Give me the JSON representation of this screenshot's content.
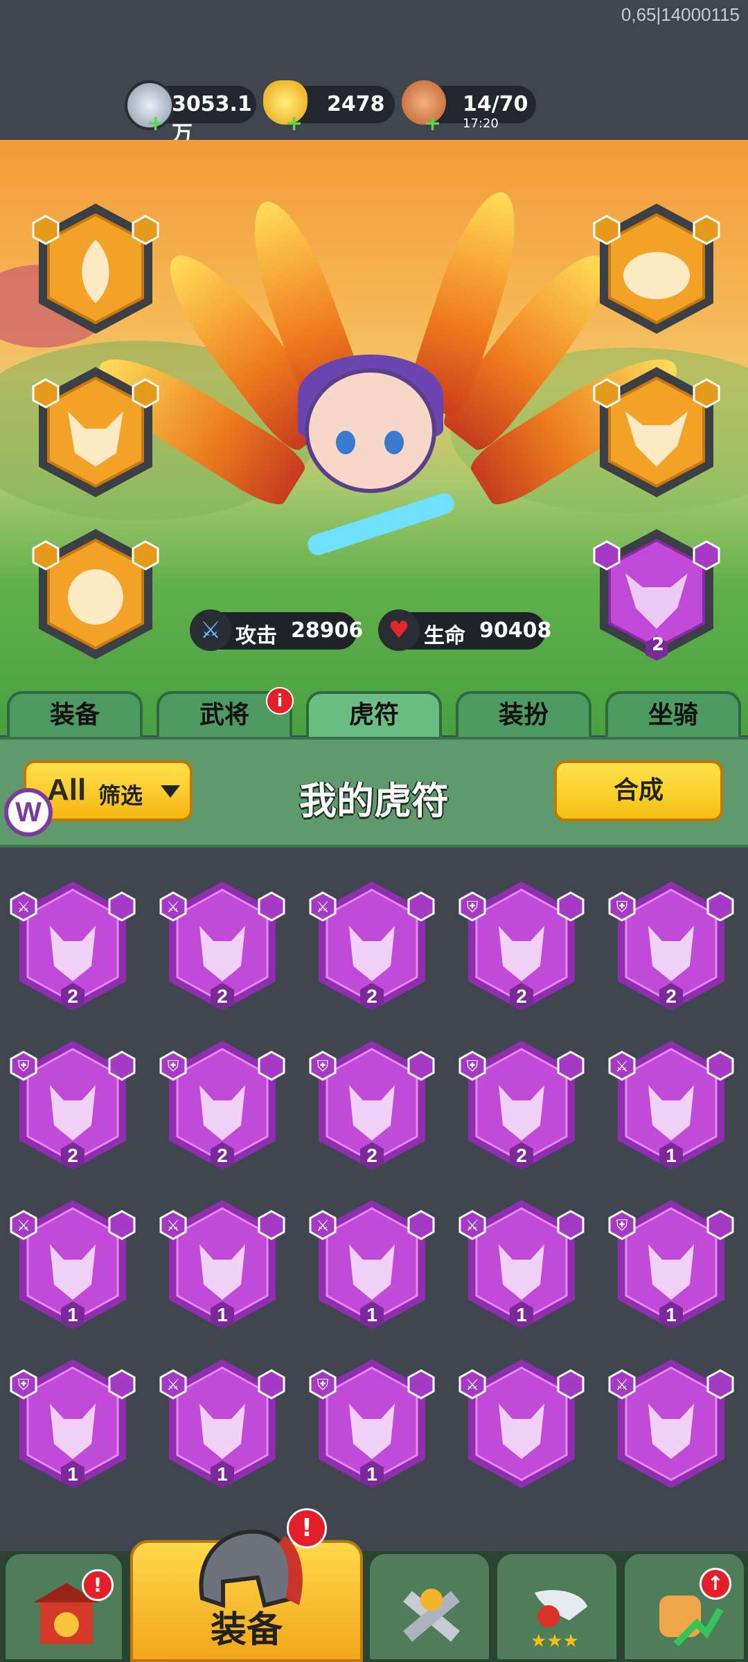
{
  "debug_text": "0,65|14000115",
  "resources": [
    {
      "name": "silver",
      "value": "3053.1万",
      "icon": "silver-coin-icon"
    },
    {
      "name": "gold",
      "value": "2478",
      "icon": "gold-ingot-icon"
    },
    {
      "name": "stamina",
      "value": "14/70",
      "timer": "17:20",
      "icon": "meat-icon"
    }
  ],
  "stats": {
    "attack_label": "攻击",
    "attack_value": "28906",
    "hp_label": "生命",
    "hp_value": "90408"
  },
  "equipped_slots": [
    {
      "side": "left",
      "beast": "phoenix",
      "rarity": "orange",
      "level": ""
    },
    {
      "side": "left",
      "beast": "fox",
      "rarity": "orange",
      "level": ""
    },
    {
      "side": "left",
      "beast": "lion",
      "rarity": "orange",
      "level": ""
    },
    {
      "side": "right",
      "beast": "turtle",
      "rarity": "orange",
      "level": ""
    },
    {
      "side": "right",
      "beast": "ox-skull",
      "rarity": "orange",
      "level": ""
    },
    {
      "side": "right",
      "beast": "ox-skull",
      "rarity": "purple",
      "level": "2"
    }
  ],
  "tabs": [
    {
      "label": "装备",
      "active": false,
      "badge": ""
    },
    {
      "label": "武将",
      "active": false,
      "badge": "i"
    },
    {
      "label": "虎符",
      "active": true,
      "badge": ""
    },
    {
      "label": "装扮",
      "active": false,
      "badge": ""
    },
    {
      "label": "坐骑",
      "active": false,
      "badge": ""
    }
  ],
  "filter": {
    "all_label": "All",
    "label": "筛选"
  },
  "title": "我的虎符",
  "compose_label": "合成",
  "logo_letter": "W",
  "items": [
    {
      "beast": "deer",
      "type": "sword",
      "level": "2"
    },
    {
      "beast": "tiger",
      "type": "sword",
      "level": "2"
    },
    {
      "beast": "dragon",
      "type": "sword",
      "level": "2"
    },
    {
      "beast": "dragon",
      "type": "shield",
      "level": "2"
    },
    {
      "beast": "wolf",
      "type": "shield",
      "level": "2"
    },
    {
      "beast": "turtle",
      "type": "shield",
      "level": "2"
    },
    {
      "beast": "phoenix",
      "type": "shield",
      "level": "2"
    },
    {
      "beast": "boar",
      "type": "shield",
      "level": "2"
    },
    {
      "beast": "snake",
      "type": "shield",
      "level": "2"
    },
    {
      "beast": "deer",
      "type": "sword",
      "level": "1"
    },
    {
      "beast": "lion",
      "type": "sword",
      "level": "1"
    },
    {
      "beast": "tiger",
      "type": "sword",
      "level": "1"
    },
    {
      "beast": "whale",
      "type": "sword",
      "level": "1"
    },
    {
      "beast": "dragon",
      "type": "sword",
      "level": "1"
    },
    {
      "beast": "ox-skull",
      "type": "shield",
      "level": "1"
    },
    {
      "beast": "turtle",
      "type": "shield",
      "level": "1"
    },
    {
      "beast": "phoenix",
      "type": "sword",
      "level": "1"
    },
    {
      "beast": "snake",
      "type": "shield",
      "level": "1"
    },
    {
      "beast": "deer",
      "type": "sword",
      "level": ""
    },
    {
      "beast": "fox",
      "type": "sword",
      "level": ""
    }
  ],
  "bottom_nav": [
    {
      "name": "shop",
      "label": "",
      "active": false,
      "badge": "!"
    },
    {
      "name": "equipment",
      "label": "装备",
      "active": true,
      "badge": "!"
    },
    {
      "name": "heroes",
      "label": "",
      "active": false,
      "badge": ""
    },
    {
      "name": "upgrade",
      "label": "",
      "active": false,
      "badge": ""
    },
    {
      "name": "boost",
      "label": "",
      "active": false,
      "badge": "↑"
    }
  ],
  "colors": {
    "purple": "#c14ad8",
    "orange": "#f2a226",
    "accent_green": "#4d9a62",
    "yellow": "#ffd21e"
  }
}
